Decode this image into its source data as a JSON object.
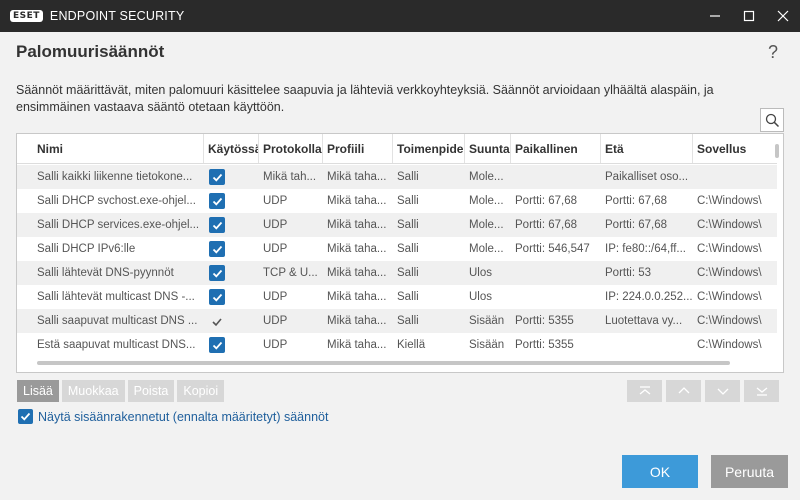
{
  "titlebar": {
    "logo_text": "ESET",
    "app_title": "ENDPOINT SECURITY"
  },
  "dialog": {
    "title": "Palomuurisäännöt",
    "help": "?",
    "description": "Säännöt määrittävät, miten palomuuri käsittelee saapuvia ja lähteviä verkkoyhteyksiä. Säännöt arvioidaan ylhäältä alaspäin, ja ensimmäinen vastaava sääntö otetaan käyttöön."
  },
  "table": {
    "columns": [
      "Nimi",
      "Käytössä",
      "Protokolla",
      "Profiili",
      "Toimenpide",
      "Suunta",
      "Paikallinen",
      "Etä",
      "Sovellus"
    ],
    "rows": [
      {
        "name": "Salli kaikki liikenne tietokone...",
        "enabled": "checkbox",
        "protocol": "Mikä tah...",
        "profile": "Mikä taha...",
        "action": "Salli",
        "direction": "Mole...",
        "local": "",
        "remote": "Paikalliset oso...",
        "app": ""
      },
      {
        "name": "Salli DHCP svchost.exe-ohjel...",
        "enabled": "checkbox",
        "protocol": "UDP",
        "profile": "Mikä taha...",
        "action": "Salli",
        "direction": "Mole...",
        "local": "Portti: 67,68",
        "remote": "Portti: 67,68",
        "app": "C:\\Windows\\"
      },
      {
        "name": "Salli DHCP services.exe-ohjel...",
        "enabled": "checkbox",
        "protocol": "UDP",
        "profile": "Mikä taha...",
        "action": "Salli",
        "direction": "Mole...",
        "local": "Portti: 67,68",
        "remote": "Portti: 67,68",
        "app": "C:\\Windows\\"
      },
      {
        "name": "Salli DHCP IPv6:lle",
        "enabled": "checkbox",
        "protocol": "UDP",
        "profile": "Mikä taha...",
        "action": "Salli",
        "direction": "Mole...",
        "local": "Portti: 546,547",
        "remote": "IP: fe80::/64,ff...",
        "app": "C:\\Windows\\"
      },
      {
        "name": "Salli lähtevät DNS-pyynnöt",
        "enabled": "checkbox",
        "protocol": "TCP & U...",
        "profile": "Mikä taha...",
        "action": "Salli",
        "direction": "Ulos",
        "local": "",
        "remote": "Portti: 53",
        "app": "C:\\Windows\\"
      },
      {
        "name": "Salli lähtevät multicast DNS -...",
        "enabled": "checkbox",
        "protocol": "UDP",
        "profile": "Mikä taha...",
        "action": "Salli",
        "direction": "Ulos",
        "local": "",
        "remote": "IP: 224.0.0.252...",
        "app": "C:\\Windows\\"
      },
      {
        "name": "Salli saapuvat multicast DNS ...",
        "enabled": "check",
        "protocol": "UDP",
        "profile": "Mikä taha...",
        "action": "Salli",
        "direction": "Sisään",
        "local": "Portti: 5355",
        "remote": "Luotettava vy...",
        "app": "C:\\Windows\\"
      },
      {
        "name": "Estä saapuvat multicast DNS...",
        "enabled": "checkbox",
        "protocol": "UDP",
        "profile": "Mikä taha...",
        "action": "Kiellä",
        "direction": "Sisään",
        "local": "Portti: 5355",
        "remote": "",
        "app": "C:\\Windows\\"
      }
    ]
  },
  "actions": {
    "add": "Lisää",
    "edit": "Muokkaa",
    "remove": "Poista",
    "copy": "Kopioi"
  },
  "builtin_label": "Näytä sisäänrakennetut (ennalta määritetyt) säännöt",
  "footer": {
    "ok": "OK",
    "cancel": "Peruuta"
  },
  "colors": {
    "titlebar": "#2a2a2a",
    "checkbox": "#1f6fb2",
    "ok_button": "#3d9ad9",
    "cancel_button": "#9a9a9a",
    "link_text": "#1f5f9c"
  },
  "icons": {
    "minimize": "minimize-icon",
    "maximize": "maximize-icon",
    "close": "close-icon",
    "search": "search-icon",
    "move_top": "move-top-icon",
    "move_up": "move-up-icon",
    "move_down": "move-down-icon",
    "move_bottom": "move-bottom-icon"
  }
}
